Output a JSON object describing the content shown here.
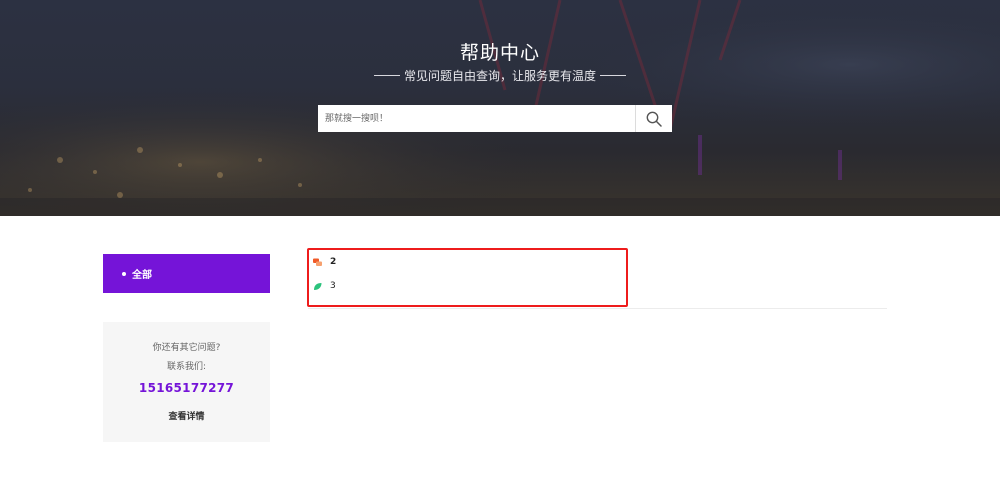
{
  "hero": {
    "title": "帮助中心",
    "subtitle": "常见问题自由查询，让服务更有温度"
  },
  "search": {
    "placeholder": "那就搜一搜呗！",
    "button_icon": "search-icon"
  },
  "sidebar": {
    "category_all": "全部",
    "contact": {
      "question": "你还有其它问题?",
      "contact_label": "联系我们:",
      "phone": "15165177277",
      "details_link": "查看详情"
    }
  },
  "questions": [
    {
      "icon": "chat-bubbles-icon",
      "title": "2"
    },
    {
      "icon": "leaf-icon",
      "title": "3"
    }
  ],
  "colors": {
    "accent": "#7514d8",
    "highlight_border": "#ee1c1c",
    "hot_icon": "#f05a28",
    "leaf_icon": "#2cc37d"
  }
}
